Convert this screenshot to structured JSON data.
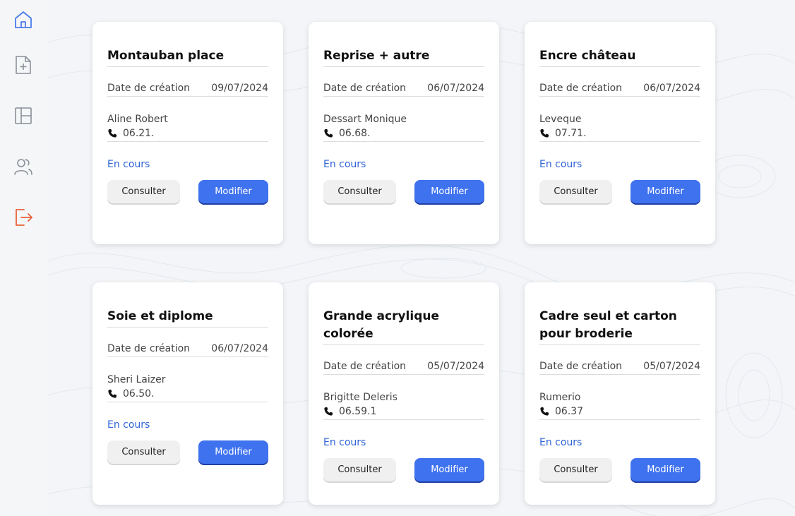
{
  "sidebar": {
    "items": [
      {
        "name": "home-icon",
        "color": "#4a7be8"
      },
      {
        "name": "file-add-icon",
        "color": "#8a8f98"
      },
      {
        "name": "layout-icon",
        "color": "#8a8f98"
      },
      {
        "name": "users-icon",
        "color": "#8a8f98"
      },
      {
        "name": "logout-icon",
        "color": "#e8623a"
      }
    ]
  },
  "labels": {
    "date_label": "Date de création",
    "consult": "Consulter",
    "modify": "Modifier"
  },
  "cards": [
    {
      "title": "Montauban place",
      "date": "09/07/2024",
      "client": "Aline Robert",
      "phone": "06.21.",
      "status": "En cours"
    },
    {
      "title": "Reprise + autre",
      "date": "06/07/2024",
      "client": "Dessart Monique",
      "phone": "06.68.",
      "status": "En cours"
    },
    {
      "title": "Encre château",
      "date": "06/07/2024",
      "client": "Leveque",
      "phone": "07.71.",
      "status": "En cours"
    },
    {
      "title": "Soie et diplome",
      "date": "06/07/2024",
      "client": "Sheri Laizer",
      "phone": "06.50.",
      "status": "En cours"
    },
    {
      "title": "Grande acrylique colorée",
      "date": "05/07/2024",
      "client": "Brigitte Deleris",
      "phone": "06.59.1",
      "status": "En cours"
    },
    {
      "title": "Cadre seul et carton pour broderie",
      "date": "05/07/2024",
      "client": "Rumerio",
      "phone": "06.37",
      "status": "En cours"
    }
  ],
  "colors": {
    "accent": "#3f72ef",
    "status": "#2f63d8",
    "logout": "#e8623a"
  }
}
